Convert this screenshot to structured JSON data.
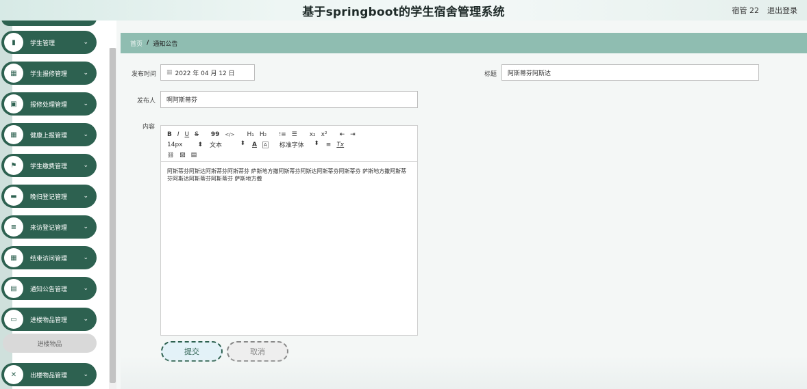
{
  "header": {
    "title": "基于springboot的学生宿舍管理系统",
    "user": "宿管 22",
    "logout": "退出登录"
  },
  "sidebar": {
    "items": [
      {
        "label": "学生管理",
        "icon": "chart-icon",
        "glyph": "▮"
      },
      {
        "label": "学生报修管理",
        "icon": "grid-icon",
        "glyph": "▦"
      },
      {
        "label": "报修处理管理",
        "icon": "bag-icon",
        "glyph": "▣"
      },
      {
        "label": "健康上报管理",
        "icon": "grid-icon",
        "glyph": "▦"
      },
      {
        "label": "学生缴费管理",
        "icon": "flag-icon",
        "glyph": "⚑"
      },
      {
        "label": "晚归登记管理",
        "icon": "chat-icon",
        "glyph": "▬"
      },
      {
        "label": "来访登记管理",
        "icon": "list-icon",
        "glyph": "≡"
      },
      {
        "label": "结束访问管理",
        "icon": "grid-icon",
        "glyph": "▦"
      },
      {
        "label": "通知公告管理",
        "icon": "clipboard-icon",
        "glyph": "▤"
      },
      {
        "label": "进楼物品管理",
        "icon": "monitor-icon",
        "glyph": "▭"
      },
      {
        "label": "出楼物品管理",
        "icon": "film-icon",
        "glyph": "✕"
      }
    ],
    "sub_item": "进楼物品"
  },
  "breadcrumb": {
    "home": "首页",
    "sep": "/",
    "current": "通知公告"
  },
  "form": {
    "publish_time_label": "发布时间",
    "publish_time_value": "2022 年 04 月 12 日",
    "title_label": "标题",
    "title_value": "阿斯蒂芬阿斯达",
    "publisher_label": "发布人",
    "publisher_value": "啊阿斯蒂芬",
    "content_label": "内容",
    "content_text": "阿斯蒂芬阿斯达阿斯蒂芬阿斯蒂芬 萨斯地方撒阿斯蒂芬阿斯达阿斯蒂芬阿斯蒂芬 萨斯地方撒阿斯蒂芬阿斯达阿斯蒂芬阿斯蒂芬 萨斯地方撒"
  },
  "toolbar": {
    "bold": "B",
    "italic": "I",
    "underline": "U",
    "strike": "S",
    "quote": "99",
    "code": "</>",
    "h1": "H₁",
    "h2": "H₂",
    "ordered_list": "⁝≡",
    "bullet_list": "☰",
    "subscript": "x₂",
    "superscript": "x²",
    "indent_left": "⇤",
    "indent_right": "⇥",
    "font_size": "14px",
    "text_style": "文本",
    "font_color": "A",
    "bg_color": "A",
    "font_family": "标准字体",
    "align": "≡",
    "clear": "Tx",
    "link": "🔗",
    "image": "▨",
    "video": "▤"
  },
  "buttons": {
    "submit": "提交",
    "cancel": "取消"
  }
}
